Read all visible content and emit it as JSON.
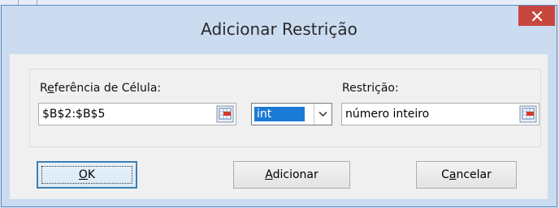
{
  "window": {
    "title": "Adicionar Restrição",
    "close_icon": "close-icon"
  },
  "constraint": {
    "cell_reference_label_accel": "e",
    "cell_reference_label_pre": "R",
    "cell_reference_label_post": "ferência de Célula:",
    "cell_reference_value": "$B$2:$B$5",
    "operator_value": "int",
    "constraint_label": "Restrição:",
    "constraint_value": "número inteiro"
  },
  "buttons": {
    "ok_accel": "O",
    "ok_rest": "K",
    "add_accel": "A",
    "add_rest": "dicionar",
    "cancel_pre": "C",
    "cancel_accel": "a",
    "cancel_rest": "ncelar"
  },
  "icons": {
    "cell_picker": "range-picker-icon",
    "dropdown": "chevron-down-icon"
  },
  "colors": {
    "close_button": "#c7463d",
    "selection": "#1a7ad4",
    "frame": "#cbdcf1"
  }
}
